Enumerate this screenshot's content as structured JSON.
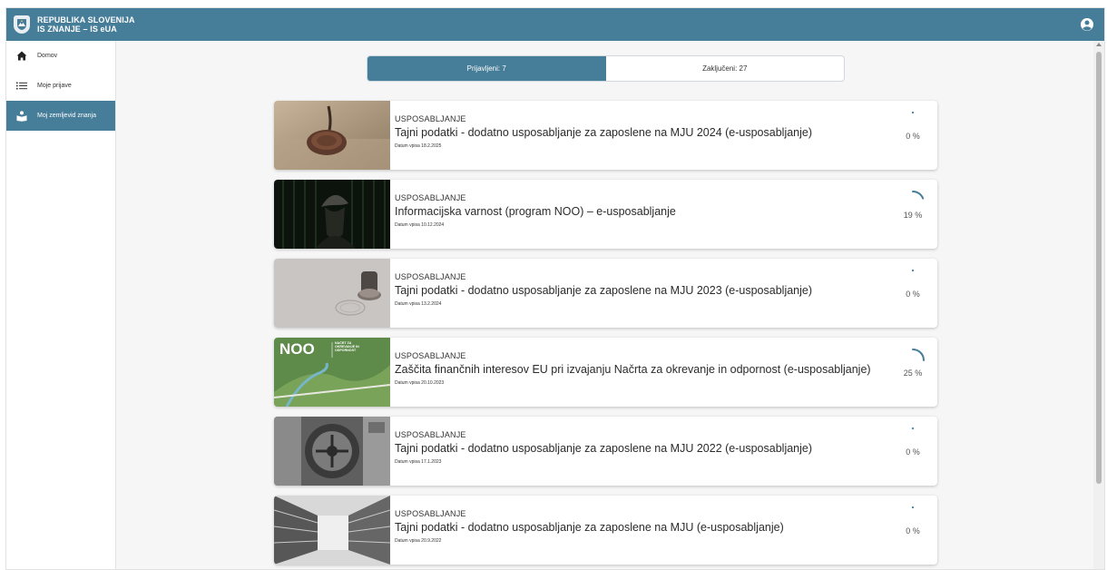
{
  "app": {
    "brand_line1": "REPUBLIKA SLOVENIJA",
    "brand_line2": "IS ZNANJE – IS eUA",
    "accent_color": "#467d99",
    "user_icon": "user-circle-icon"
  },
  "sidebar": {
    "items": [
      {
        "label": "Domov",
        "icon": "home-icon"
      },
      {
        "label": "Moje prijave",
        "icon": "list-icon"
      },
      {
        "label": "Moj zemljevid znanja",
        "icon": "reader-icon",
        "active": true
      }
    ]
  },
  "tabs": [
    {
      "label": "Prijavljeni: 7",
      "active": true
    },
    {
      "label": "Zaključeni: 27",
      "active": false
    }
  ],
  "courses": [
    {
      "category": "USPOSABLJANJE",
      "title": "Tajni podatki - dodatno usposabljanje za zaposlene na MJU 2024 (e-usposabljanje)",
      "date": "Datum vpisa 18.2.2025",
      "progress": 0,
      "progress_label": "0 %"
    },
    {
      "category": "USPOSABLJANJE",
      "title": "Informacijska varnost (program NOO) – e-usposabljanje",
      "date": "Datum vpisa 10.12.2024",
      "progress": 19,
      "progress_label": "19 %"
    },
    {
      "category": "USPOSABLJANJE",
      "title": "Tajni podatki - dodatno usposabljanje za zaposlene na MJU 2023 (e-usposabljanje)",
      "date": "Datum vpisa 13.2.2024",
      "progress": 0,
      "progress_label": "0 %"
    },
    {
      "category": "USPOSABLJANJE",
      "title": "Zaščita finančnih interesov EU pri izvajanju Načrta za okrevanje in odpornost (e-usposabljanje)",
      "date": "Datum vpisa 20.10.2023",
      "progress": 25,
      "progress_label": "25 %",
      "thumb_logo": "NOO",
      "thumb_caption": "NAČRT ZA OKREVANJE IN ODPORNOST"
    },
    {
      "category": "USPOSABLJANJE",
      "title": "Tajni podatki - dodatno usposabljanje za zaposlene na MJU 2022 (e-usposabljanje)",
      "date": "Datum vpisa 17.1.2023",
      "progress": 0,
      "progress_label": "0 %"
    },
    {
      "category": "USPOSABLJANJE",
      "title": "Tajni podatki - dodatno usposabljanje za zaposlene na MJU (e-usposabljanje)",
      "date": "Datum vpisa 20.9.2022",
      "progress": 0,
      "progress_label": "0 %"
    }
  ]
}
